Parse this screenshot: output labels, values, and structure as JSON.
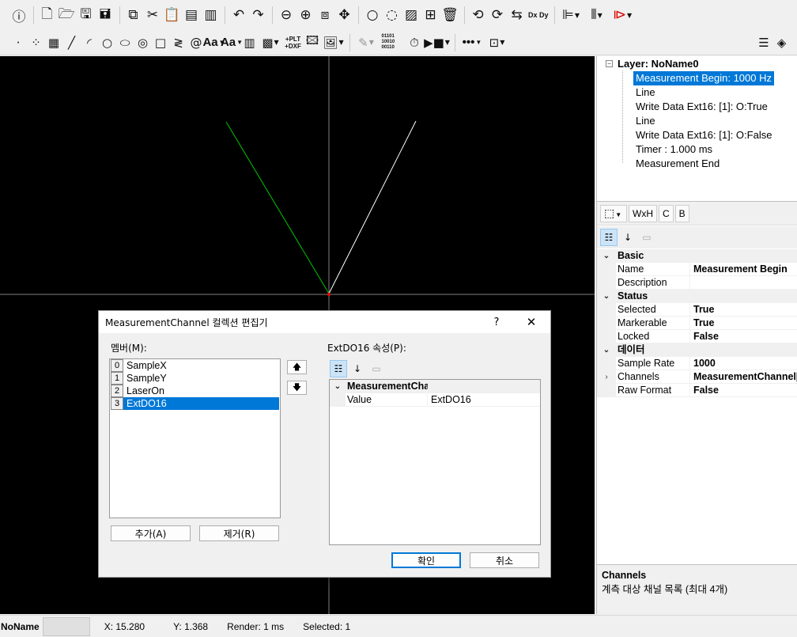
{
  "toolbar1": {
    "icons": [
      "info-icon",
      "new-file-icon",
      "open-folder-icon",
      "save-icon",
      "save-as-icon",
      "copy-icon",
      "cut-icon",
      "paste-icon",
      "paste-special-icon",
      "clipboard-icon",
      "undo-icon",
      "redo-icon",
      "zoom-out-icon",
      "zoom-in-icon",
      "zoom-window-icon",
      "pan-icon",
      "circle-select-icon",
      "lasso-icon",
      "hatch-icon",
      "split-icon",
      "trash-icon",
      "rotate-left-icon",
      "rotate-right-icon",
      "rotate-cycle-icon",
      "align-left-icon",
      "columns-icon",
      "play-red-icon"
    ],
    "dxdy_label": "Dx Dy"
  },
  "toolbar2": {
    "text_label": "Aa",
    "bold_text_label": "Aa",
    "plt_label": "+PLT",
    "dxf_label": "+DXF",
    "binary_label": "01101 10010 00110",
    "more_label": "•••"
  },
  "tree": {
    "root": "Layer: NoName0",
    "items": [
      "Measurement Begin: 1000 Hz",
      "Line",
      "Write Data Ext16: [1]: O:True",
      "Line",
      "Write Data Ext16: [1]: O:False",
      "Timer : 1.000 ms",
      "Measurement End"
    ]
  },
  "prop_tabs": {
    "wxh": "WxH",
    "c": "C",
    "b": "B"
  },
  "props": {
    "cat_basic": "Basic",
    "name_k": "Name",
    "name_v": "Measurement Begin",
    "desc_k": "Description",
    "desc_v": "",
    "cat_status": "Status",
    "selected_k": "Selected",
    "selected_v": "True",
    "markerable_k": "Markerable",
    "markerable_v": "True",
    "locked_k": "Locked",
    "locked_v": "False",
    "cat_data": "데이터",
    "rate_k": "Sample Rate",
    "rate_v": "1000",
    "channels_k": "Channels",
    "channels_v": "MeasurementChannel[]",
    "raw_k": "Raw Format",
    "raw_v": "False"
  },
  "help": {
    "title": "Channels",
    "desc": "계측 대상 채널 목록 (최대 4개)"
  },
  "status": {
    "doc": "NoName",
    "x": "X: 15.280",
    "y": "Y: 1.368",
    "render": "Render: 1 ms",
    "selected": "Selected: 1"
  },
  "dialog": {
    "title": "MeasurementChannel 컬렉션 편집기",
    "help_btn": "?",
    "close_btn": "✕",
    "members_label": "멤버(M):",
    "members": [
      {
        "idx": "0",
        "name": "SampleX"
      },
      {
        "idx": "1",
        "name": "SampleY"
      },
      {
        "idx": "2",
        "name": "LaserOn"
      },
      {
        "idx": "3",
        "name": "ExtDO16"
      }
    ],
    "props_label": "ExtDO16 속성(P):",
    "prop_cat": "MeasurementChannel",
    "prop_k": "Value",
    "prop_v": "ExtDO16",
    "add_btn": "추가(A)",
    "remove_btn": "제거(R)",
    "ok_btn": "확인",
    "cancel_btn": "취소"
  },
  "canvas_colors": {
    "axis": "#808080",
    "green_line": "#00c800",
    "white_line": "#ffffff",
    "origin": "#ff0000"
  }
}
